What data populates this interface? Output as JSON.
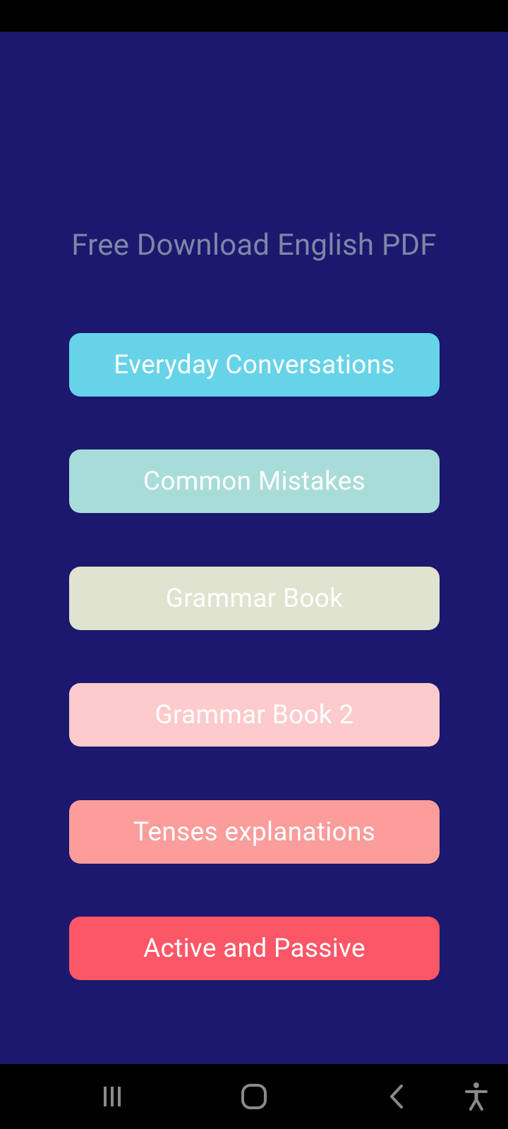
{
  "app": {
    "title": "Free Download English PDF",
    "buttons": [
      {
        "label": "Everyday Conversations",
        "color": "#66d3e8"
      },
      {
        "label": "Common Mistakes",
        "color": "#a8dcd9"
      },
      {
        "label": "Grammar Book",
        "color": "#e0e3cf"
      },
      {
        "label": "Grammar Book 2",
        "color": "#fdcbcc"
      },
      {
        "label": "Tenses explanations",
        "color": "#fb9d9b"
      },
      {
        "label": "Active and Passive",
        "color": "#fb5767"
      }
    ],
    "background_color": "#1b186d",
    "title_color": "#7d86a8"
  },
  "system_nav": {
    "icons": [
      "recents-icon",
      "home-icon",
      "back-icon",
      "accessibility-icon"
    ],
    "icon_color": "#8a8a8a"
  }
}
